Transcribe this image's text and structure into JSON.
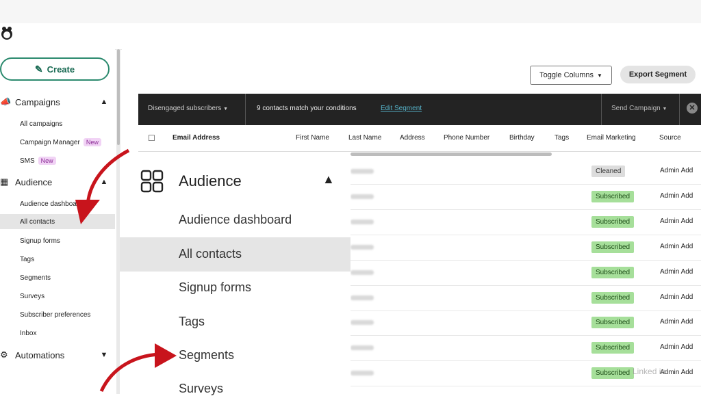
{
  "sidebar": {
    "create_label": "Create",
    "campaigns": {
      "label": "Campaigns",
      "icon": "megaphone-icon",
      "items": [
        {
          "label": "All campaigns",
          "badge": ""
        },
        {
          "label": "Campaign Manager",
          "badge": "New"
        },
        {
          "label": "SMS",
          "badge": "New"
        }
      ]
    },
    "audience": {
      "label": "Audience",
      "icon": "audience-icon",
      "items": [
        {
          "label": "Audience dashboard"
        },
        {
          "label": "All contacts",
          "active": true
        },
        {
          "label": "Signup forms"
        },
        {
          "label": "Tags"
        },
        {
          "label": "Segments"
        },
        {
          "label": "Surveys"
        },
        {
          "label": "Subscriber preferences"
        },
        {
          "label": "Inbox"
        }
      ]
    },
    "automations": {
      "label": "Automations",
      "icon": "automations-icon"
    }
  },
  "toolbar": {
    "toggle_columns": "Toggle Columns",
    "export_segment": "Export Segment"
  },
  "segment_bar": {
    "segment_name": "Disengaged subscribers",
    "match_text": "9 contacts match your conditions",
    "edit_link": "Edit Segment",
    "send_campaign": "Send Campaign"
  },
  "table": {
    "columns": [
      "Email Address",
      "First Name",
      "Last Name",
      "Address",
      "Phone Number",
      "Birthday",
      "Tags",
      "Email Marketing",
      "Source"
    ],
    "rows": [
      {
        "status": "Cleaned",
        "source": "Admin Add"
      },
      {
        "status": "Subscribed",
        "source": "Admin Add"
      },
      {
        "status": "Subscribed",
        "source": "Admin Add"
      },
      {
        "status": "Subscribed",
        "source": "Admin Add"
      },
      {
        "status": "Subscribed",
        "source": "Admin Add"
      },
      {
        "status": "Subscribed",
        "source": "Admin Add"
      },
      {
        "status": "Subscribed",
        "source": "Admin Add"
      },
      {
        "status": "Subscribed",
        "source": "Admin Add"
      },
      {
        "status": "Subscribed",
        "source": "Admin Add"
      }
    ]
  },
  "zoom_panel": {
    "title": "Audience",
    "items": [
      "Audience dashboard",
      "All contacts",
      "Signup forms",
      "Tags",
      "Segments",
      "Surveys"
    ]
  },
  "watermark": "Linked in",
  "colors": {
    "accent": "#2b8a6e",
    "subscribed": "#a6df9a",
    "arrow": "#c8141c",
    "dark_bar": "#232323"
  }
}
